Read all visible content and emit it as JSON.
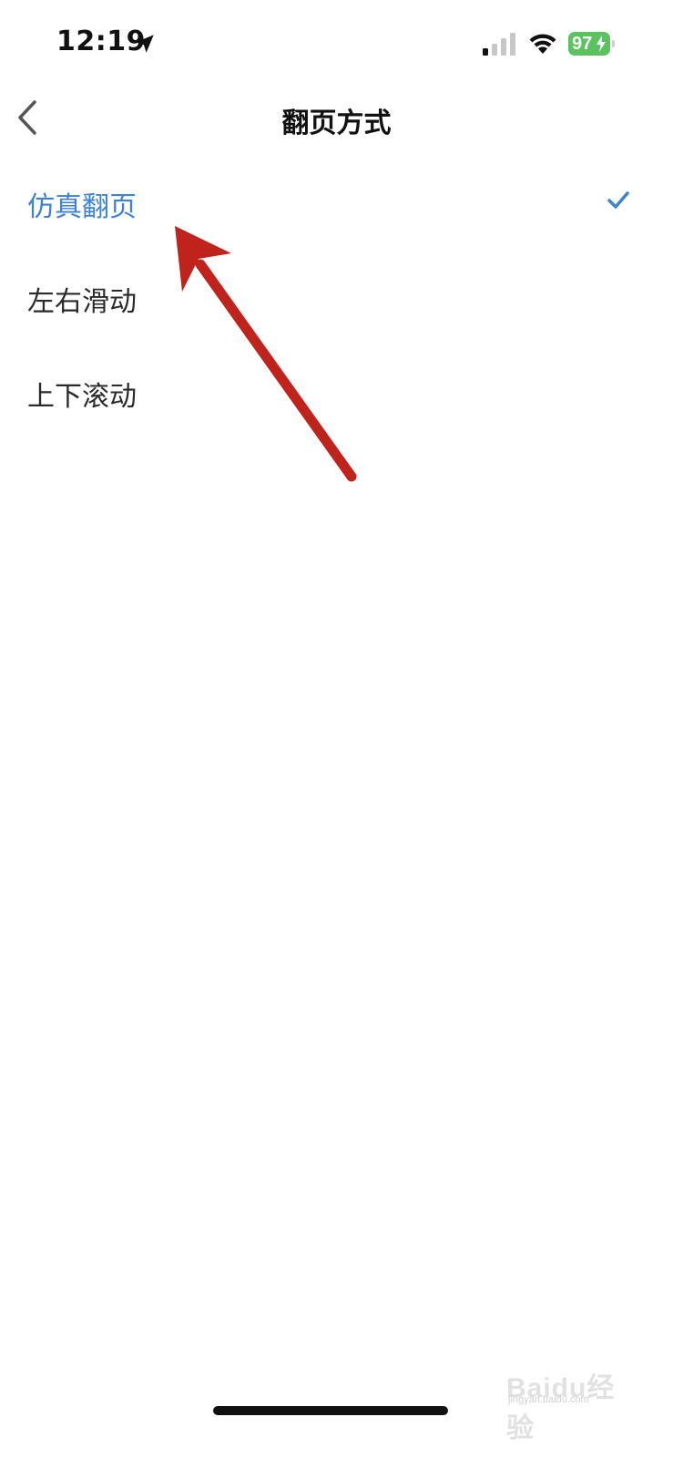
{
  "status_bar": {
    "time": "12:19",
    "battery_level": "97",
    "battery_color": "#5ac25f",
    "icons": [
      "location-arrow-icon",
      "cellular-signal-icon",
      "wifi-icon",
      "battery-charging-icon"
    ]
  },
  "nav": {
    "title": "翻页方式",
    "back_icon": "chevron-left-icon"
  },
  "options": [
    {
      "label": "仿真翻页",
      "selected": true
    },
    {
      "label": "左右滑动",
      "selected": false
    },
    {
      "label": "上下滚动",
      "selected": false
    }
  ],
  "colors": {
    "accent": "#3e82d6",
    "annotation": "#c0231b"
  },
  "watermark": {
    "text": "Baidu经验",
    "sub": "jingyan.baidu.com"
  }
}
